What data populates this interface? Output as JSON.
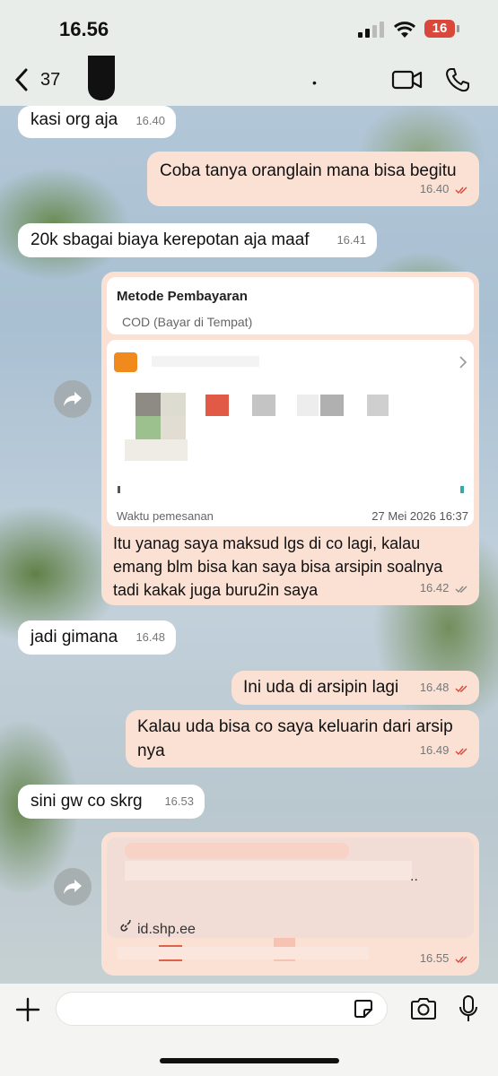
{
  "status": {
    "time": "16.56",
    "battery": "16"
  },
  "header": {
    "unread_count": "37",
    "indicator": "•"
  },
  "messages": [
    {
      "text": "kasi org aja",
      "time": "16.40"
    },
    {
      "text": "Coba tanya oranglain mana bisa begitu",
      "time": "16.40"
    },
    {
      "text": "20k sbagai biaya kerepotan aja maaf",
      "time": "16.41"
    },
    {
      "text": "Itu yanag saya maksud lgs di co lagi, kalau emang blm bisa kan saya bisa arsipin soalnya tadi kakak juga buru2in saya",
      "time": "16.42"
    },
    {
      "text": "jadi gimana",
      "time": "16.48"
    },
    {
      "text": "Ini uda di arsipin lagi",
      "time": "16.48"
    },
    {
      "text": "Kalau uda bisa co saya keluarin dari arsip nya",
      "time": "16.49"
    },
    {
      "text": "sini gw co skrg",
      "time": "16.53"
    },
    {
      "text": "",
      "time": "16.55"
    }
  ],
  "order_card": {
    "payment_label": "Metode Pembayaran",
    "payment_value": "COD (Bayar di Tempat)",
    "order_time_label": "Waktu pemesanan",
    "order_time_value": "27 Mei 2026 16:37"
  },
  "link_preview": {
    "dots": "..",
    "url": "id.shp.ee"
  },
  "colors": {
    "outgoing": "#fbe0d4",
    "incoming": "#ffffff",
    "tick_read": "#d9483b",
    "tick_delivered": "#888888"
  }
}
